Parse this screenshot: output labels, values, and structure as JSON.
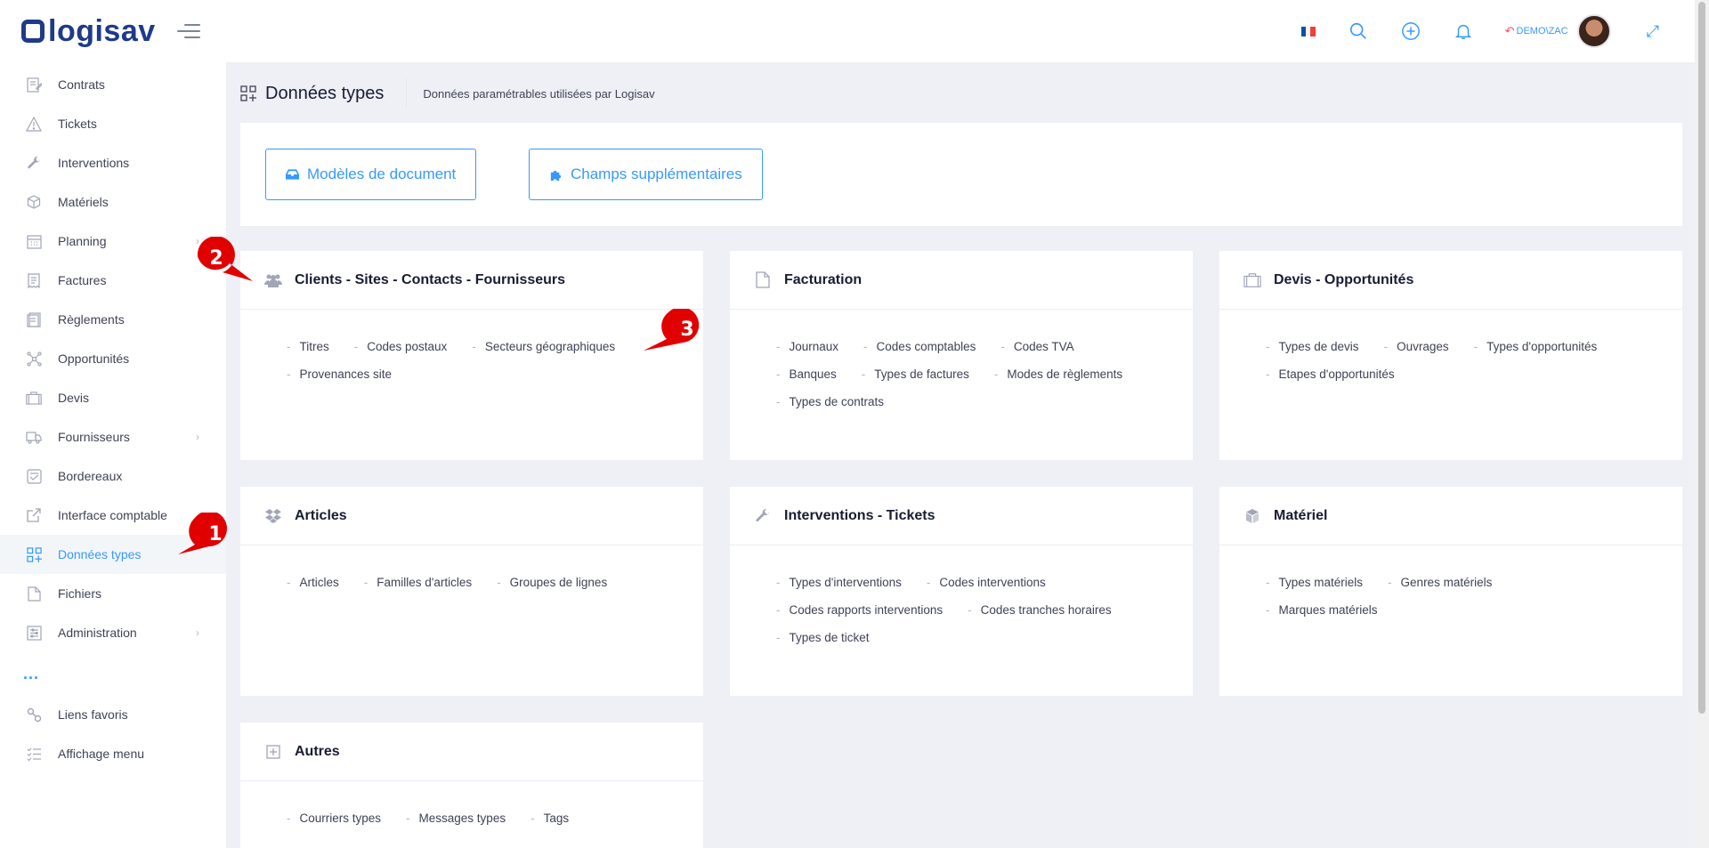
{
  "app": {
    "logo_text": "logisav"
  },
  "header": {
    "user": "DEMO\\ZAC",
    "flag_colors": [
      "#0055a4",
      "#ffffff",
      "#ef4135"
    ]
  },
  "sidebar": {
    "items": [
      {
        "label": "Contrats",
        "icon": "contract-icon"
      },
      {
        "label": "Tickets",
        "icon": "warning-icon"
      },
      {
        "label": "Interventions",
        "icon": "wrench-icon"
      },
      {
        "label": "Matériels",
        "icon": "box-icon"
      },
      {
        "label": "Planning",
        "icon": "calendar-icon",
        "chevron": true
      },
      {
        "label": "Factures",
        "icon": "invoice-icon"
      },
      {
        "label": "Règlements",
        "icon": "payment-icon"
      },
      {
        "label": "Opportunités",
        "icon": "network-icon"
      },
      {
        "label": "Devis",
        "icon": "briefcase-icon"
      },
      {
        "label": "Fournisseurs",
        "icon": "truck-icon",
        "chevron": true
      },
      {
        "label": "Bordereaux",
        "icon": "slip-icon"
      },
      {
        "label": "Interface comptable",
        "icon": "external-link-icon"
      },
      {
        "label": "Données types",
        "icon": "grid-plus-icon",
        "active": true
      },
      {
        "label": "Fichiers",
        "icon": "file-icon"
      },
      {
        "label": "Administration",
        "icon": "settings-list-icon",
        "chevron": true
      }
    ],
    "more": "...",
    "bottom_items": [
      {
        "label": "Liens favoris",
        "icon": "link-icon"
      },
      {
        "label": "Affichage menu",
        "icon": "checklist-icon"
      }
    ]
  },
  "subheader": {
    "title": "Données types",
    "description": "Données paramétrables utilisées par Logisav"
  },
  "buttons": {
    "documents": "Modèles de document",
    "fields": "Champs supplémentaires"
  },
  "cards": [
    {
      "title": "Clients - Sites - Contacts - Fournisseurs",
      "icon": "users-icon",
      "links": [
        "Titres",
        "Codes postaux",
        "Secteurs géographiques",
        "Provenances site"
      ]
    },
    {
      "title": "Facturation",
      "icon": "document-icon",
      "links": [
        "Journaux",
        "Codes comptables",
        "Codes TVA",
        "Banques",
        "Types de factures",
        "Modes de règlements",
        "Types de contrats"
      ]
    },
    {
      "title": "Devis - Opportunités",
      "icon": "briefcase-icon",
      "links": [
        "Types de devis",
        "Ouvrages",
        "Types d'opportunités",
        "Etapes d'opportunités"
      ]
    },
    {
      "title": "Articles",
      "icon": "dropbox-icon",
      "links": [
        "Articles",
        "Familles d'articles",
        "Groupes de lignes"
      ]
    },
    {
      "title": "Interventions - Tickets",
      "icon": "wrench-icon",
      "links": [
        "Types d'interventions",
        "Codes interventions",
        "Codes rapports interventions",
        "Codes tranches horaires",
        "Types de ticket"
      ]
    },
    {
      "title": "Matériel",
      "icon": "cube-icon",
      "links": [
        "Types matériels",
        "Genres matériels",
        "Marques matériels"
      ]
    },
    {
      "title": "Autres",
      "icon": "plus-square-icon",
      "links": [
        "Courriers types",
        "Messages types",
        "Tags"
      ]
    }
  ],
  "markers": [
    "1",
    "2",
    "3"
  ],
  "colors": {
    "accent": "#3699ff",
    "marker": "#e00000"
  }
}
